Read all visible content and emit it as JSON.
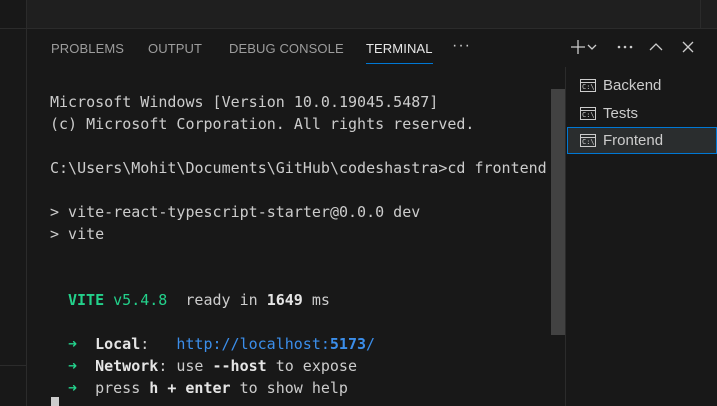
{
  "panel": {
    "tabs": [
      {
        "label": "PROBLEMS"
      },
      {
        "label": "OUTPUT"
      },
      {
        "label": "DEBUG CONSOLE"
      },
      {
        "label": "TERMINAL",
        "active": true
      }
    ],
    "more_icon": "ellipsis-icon",
    "actions": {
      "new_terminal_icon": "plus-icon",
      "dropdown_icon": "chevron-down-icon",
      "more_icon": "ellipsis-icon",
      "maximize_icon": "chevron-up-icon",
      "close_icon": "close-icon"
    }
  },
  "terminal": {
    "line1": "Microsoft Windows [Version 10.0.19045.5487]",
    "line2": "(c) Microsoft Corporation. All rights reserved.",
    "prompt": "C:\\Users\\Mohit\\Documents\\GitHub\\codeshastra>cd frontend",
    "npm1": "> vite-react-typescript-starter@0.0.0 dev",
    "npm2": "> vite",
    "vite_name": "VITE",
    "vite_version": "v5.4.8",
    "ready_text": "ready in",
    "ready_ms": "1649",
    "ms_unit": "ms",
    "arrow": "➜",
    "local_label": "Local",
    "local_url_prefix": "http://localhost:",
    "local_port": "5173",
    "local_url_suffix": "/",
    "network_label": "Network",
    "network_text_1": "use",
    "network_flag": "--host",
    "network_text_2": "to expose",
    "help_text_1": "press",
    "help_key": "h + enter",
    "help_text_2": "to show help"
  },
  "terminals": [
    {
      "label": "Backend",
      "icon": "terminal-cmd-icon"
    },
    {
      "label": "Tests",
      "icon": "terminal-cmd-icon"
    },
    {
      "label": "Frontend",
      "icon": "terminal-cmd-icon",
      "selected": true
    }
  ],
  "colors": {
    "accent": "#0078d4",
    "vite_green": "#23d18b",
    "url_blue": "#3b8eea"
  }
}
